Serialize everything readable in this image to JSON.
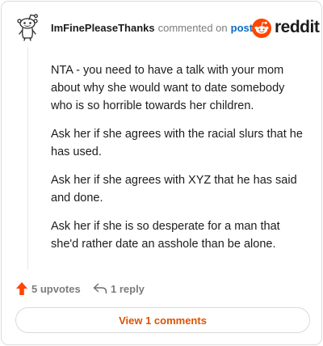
{
  "header": {
    "author": "ImFinePleaseThanks",
    "action_text": "commented on",
    "post_link": "post",
    "brand_name": "reddit"
  },
  "icons": {
    "avatar": "snoo-avatar-icon",
    "brand": "reddit-logo-icon",
    "upvote": "upvote-arrow-icon",
    "reply": "reply-arrow-icon"
  },
  "colors": {
    "brand_orange": "#ff4500",
    "link_blue": "#0a6cc2",
    "button_text": "#dd5200"
  },
  "comment": {
    "paragraphs": [
      "NTA - you need to have a talk with your mom about why she would want to date somebody who is so horrible towards her children.",
      "Ask her if she agrees with the racial slurs that he has used.",
      "Ask her if she agrees with XYZ that he has said and done.",
      "Ask her if she is so desperate for a man that she'd rather date an asshole than be alone."
    ]
  },
  "actions": {
    "upvotes_label": "5 upvotes",
    "reply_label": "1 reply"
  },
  "footer": {
    "view_comments_label": "View 1 comments"
  }
}
